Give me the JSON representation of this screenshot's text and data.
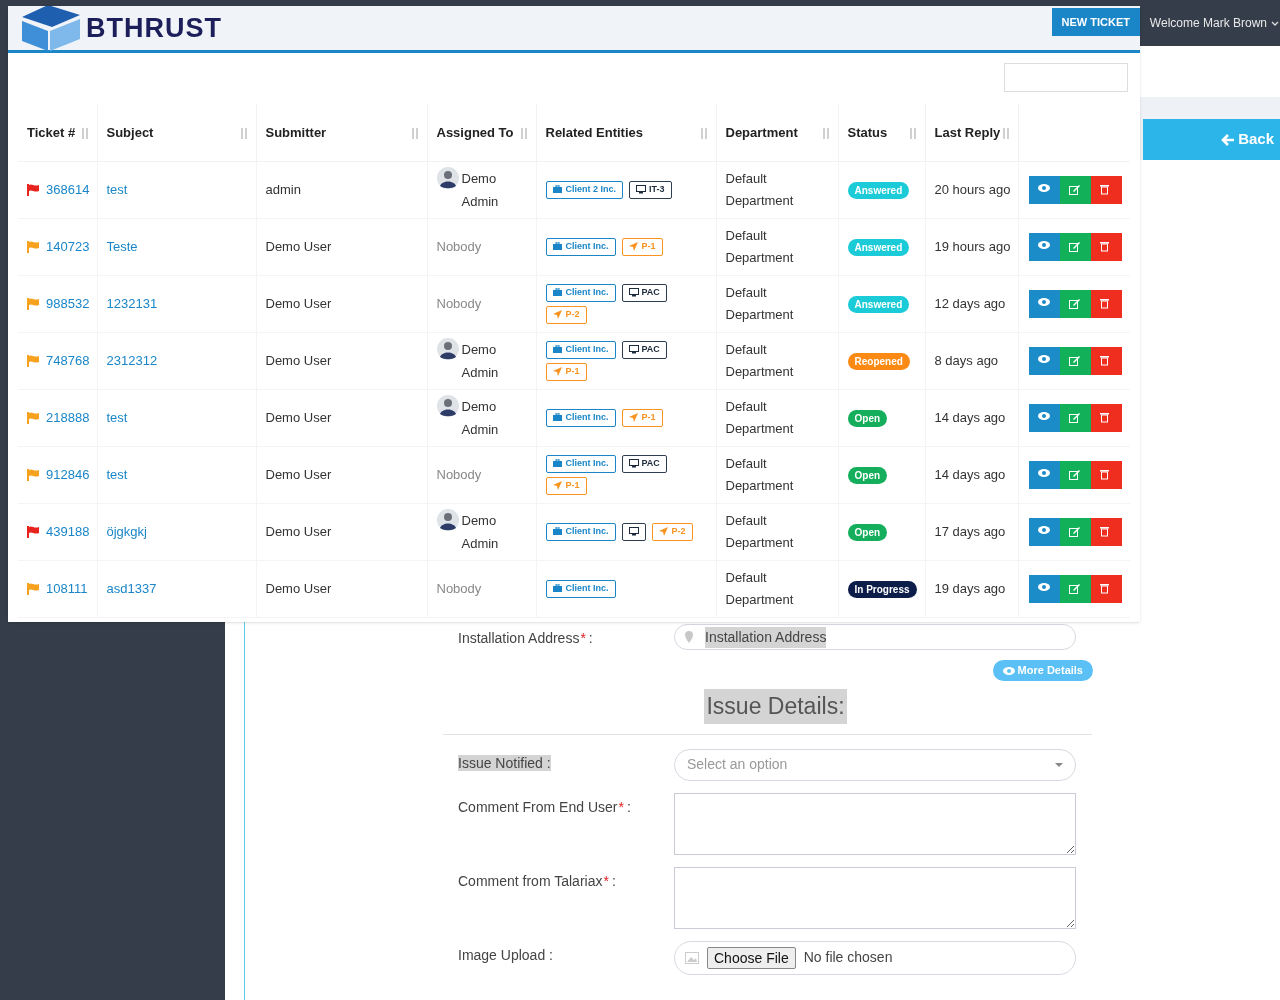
{
  "topbar": {
    "user_menu": "Welcome Mark Brown"
  },
  "back_button": "Back",
  "form": {
    "address": {
      "label": "Installation Address",
      "required_mark": "*",
      "suffix": ":",
      "value": "Installation Address"
    },
    "more_details": "More Details",
    "section_title": "Issue Details:",
    "fields": [
      {
        "kind": "select",
        "label": "Issue Notified :",
        "placeholder": "Select an option"
      },
      {
        "kind": "textarea",
        "label": "Comment From End User",
        "required_mark": "*",
        "suffix": ":"
      },
      {
        "kind": "textarea",
        "label": "Comment from Talariax",
        "required_mark": "*",
        "suffix": ":"
      },
      {
        "kind": "file",
        "label": "Image Upload :",
        "button": "Choose File",
        "status": "No file chosen"
      }
    ]
  },
  "panel": {
    "logo": "BTHRUST",
    "new_ticket": "NEW TICKET",
    "table": {
      "columns": [
        "Ticket #",
        "Subject",
        "Submitter",
        "Assigned To",
        "Related Entities",
        "Department",
        "Status",
        "Last Reply"
      ],
      "rows": [
        {
          "ticket": "368614",
          "color": "#e8231e",
          "subject": "test",
          "submitter": "admin",
          "assigned": {
            "kind": "user",
            "name": "Demo Admin"
          },
          "entities": [
            {
              "kind": "client",
              "label": "Client 2 Inc."
            },
            {
              "kind": "device",
              "label": "IT-3"
            }
          ],
          "department": "Default Department",
          "status": {
            "label": "Answered",
            "color": "#1ccbd8"
          },
          "last_reply": "20 hours ago"
        },
        {
          "ticket": "140723",
          "color": "#f7a21e",
          "subject": "Teste",
          "submitter": "Demo User",
          "assigned": {
            "kind": "none",
            "name": "Nobody"
          },
          "entities": [
            {
              "kind": "client",
              "label": "Client Inc."
            },
            {
              "kind": "priority",
              "label": "P-1"
            }
          ],
          "department": "Default Department",
          "status": {
            "label": "Answered",
            "color": "#1ccbd8"
          },
          "last_reply": "19 hours ago"
        },
        {
          "ticket": "988532",
          "color": "#f7a21e",
          "subject": "1232131",
          "submitter": "Demo User",
          "assigned": {
            "kind": "none",
            "name": "Nobody"
          },
          "entities": [
            {
              "kind": "client",
              "label": "Client Inc."
            },
            {
              "kind": "device",
              "label": "PAC"
            },
            {
              "kind": "priority",
              "label": "P-2"
            }
          ],
          "department": "Default Department",
          "status": {
            "label": "Answered",
            "color": "#1ccbd8"
          },
          "last_reply": "12 days ago"
        },
        {
          "ticket": "748768",
          "color": "#f7a21e",
          "subject": "2312312",
          "submitter": "Demo User",
          "assigned": {
            "kind": "user",
            "name": "Demo Admin"
          },
          "entities": [
            {
              "kind": "client",
              "label": "Client Inc."
            },
            {
              "kind": "device",
              "label": "PAC"
            },
            {
              "kind": "priority",
              "label": "P-1"
            }
          ],
          "department": "Default Department",
          "status": {
            "label": "Reopened",
            "color": "#fb8a15"
          },
          "last_reply": "8 days ago"
        },
        {
          "ticket": "218888",
          "color": "#f7a21e",
          "subject": "test",
          "submitter": "Demo User",
          "assigned": {
            "kind": "user",
            "name": "Demo Admin"
          },
          "entities": [
            {
              "kind": "client",
              "label": "Client Inc."
            },
            {
              "kind": "priority",
              "label": "P-1"
            }
          ],
          "department": "Default Department",
          "status": {
            "label": "Open",
            "color": "#14ae5c"
          },
          "last_reply": "14 days ago"
        },
        {
          "ticket": "912846",
          "color": "#f7a21e",
          "subject": "test",
          "submitter": "Demo User",
          "assigned": {
            "kind": "none",
            "name": "Nobody"
          },
          "entities": [
            {
              "kind": "client",
              "label": "Client Inc."
            },
            {
              "kind": "device",
              "label": "PAC"
            },
            {
              "kind": "priority",
              "label": "P-1"
            }
          ],
          "department": "Default Department",
          "status": {
            "label": "Open",
            "color": "#14ae5c"
          },
          "last_reply": "14 days ago"
        },
        {
          "ticket": "439188",
          "color": "#e8231e",
          "subject": "öjgkgkj",
          "submitter": "Demo User",
          "assigned": {
            "kind": "user",
            "name": "Demo Admin"
          },
          "entities": [
            {
              "kind": "client",
              "label": "Client Inc."
            },
            {
              "kind": "device"
            },
            {
              "kind": "priority",
              "label": "P-2"
            }
          ],
          "department": "Default Department",
          "status": {
            "label": "Open",
            "color": "#14ae5c"
          },
          "last_reply": "17 days ago"
        },
        {
          "ticket": "108111",
          "color": "#f7a21e",
          "subject": "asd1337",
          "submitter": "Demo User",
          "assigned": {
            "kind": "none",
            "name": "Nobody"
          },
          "entities": [
            {
              "kind": "client",
              "label": "Client Inc."
            }
          ],
          "department": "Default Department",
          "status": {
            "label": "In Progress",
            "color": "#0d1d4a"
          },
          "last_reply": "19 days ago"
        }
      ]
    }
  }
}
